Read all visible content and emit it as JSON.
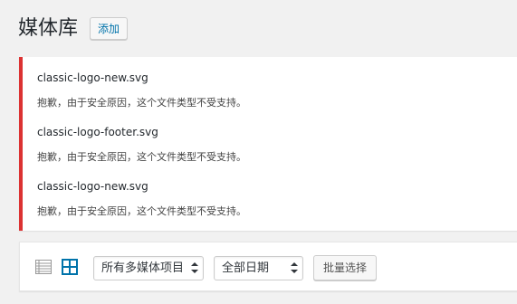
{
  "header": {
    "title": "媒体库",
    "add_label": "添加"
  },
  "errors": [
    {
      "filename": "classic-logo-new.svg",
      "message": "抱歉，由于安全原因，这个文件类型不受支持。"
    },
    {
      "filename": "classic-logo-footer.svg",
      "message": "抱歉，由于安全原因，这个文件类型不受支持。"
    },
    {
      "filename": "classic-logo-new.svg",
      "message": "抱歉，由于安全原因，这个文件类型不受支持。"
    }
  ],
  "toolbar": {
    "view_modes": [
      {
        "icon": "list-view-icon",
        "active": false
      },
      {
        "icon": "grid-view-icon",
        "active": true
      }
    ],
    "media_type_filter": "所有多媒体项目",
    "date_filter": "全部日期",
    "bulk_select_label": "批量选择"
  },
  "colors": {
    "accent": "#0073aa",
    "error": "#dc3232",
    "background": "#f1f1f1"
  }
}
